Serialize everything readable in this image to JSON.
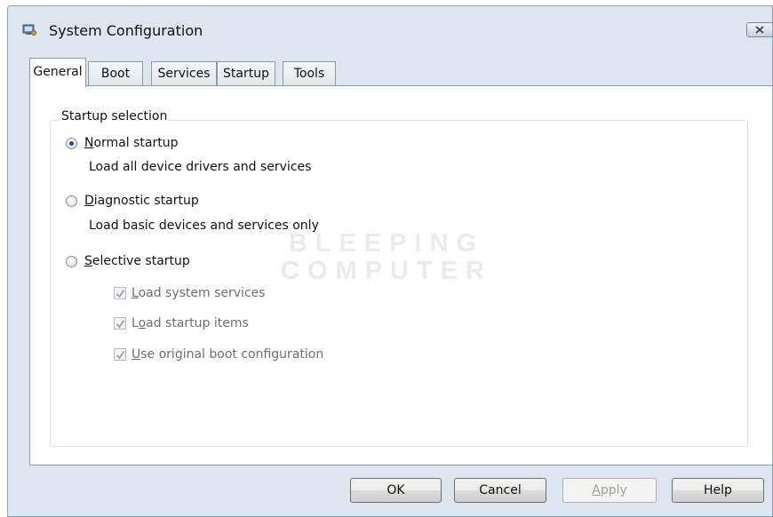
{
  "window": {
    "title": "System Configuration",
    "icon": "system-config-icon",
    "close_icon": "close-icon"
  },
  "tabs": [
    {
      "label": "General",
      "active": true
    },
    {
      "label": "Boot",
      "active": false
    },
    {
      "label": "Services",
      "active": false
    },
    {
      "label": "Startup",
      "active": false
    },
    {
      "label": "Tools",
      "active": false
    }
  ],
  "startup_selection": {
    "group_label": "Startup selection",
    "normal": {
      "label_key": "N",
      "label_rest": "ormal startup",
      "description": "Load all device drivers and services",
      "selected": true
    },
    "diagnostic": {
      "label_key": "D",
      "label_rest": "iagnostic startup",
      "description": "Load basic devices and services only",
      "selected": false
    },
    "selective": {
      "label_key": "S",
      "label_rest": "elective startup",
      "selected": false,
      "options": [
        {
          "pre": "",
          "key": "L",
          "post": "oad system services",
          "checked": true,
          "disabled": true
        },
        {
          "pre": "L",
          "key": "o",
          "post": "ad startup items",
          "checked": true,
          "disabled": true
        },
        {
          "pre": "",
          "key": "U",
          "post": "se original boot configuration",
          "checked": true,
          "disabled": true
        }
      ]
    }
  },
  "watermark": {
    "line1": "BLEEPING",
    "line2": "COMPUTER"
  },
  "buttons": {
    "ok": "OK",
    "cancel": "Cancel",
    "apply_key": "A",
    "apply_rest": "pply",
    "help": "Help"
  },
  "colors": {
    "window_frame": "#dde6ee",
    "radio_selected": "#1f4fa0",
    "disabled_text": "#6f6f6f"
  }
}
